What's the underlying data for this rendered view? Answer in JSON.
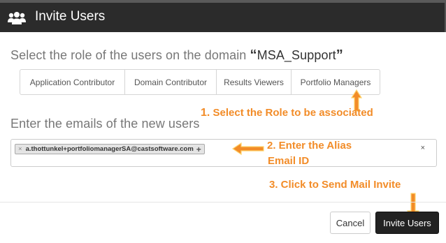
{
  "header": {
    "title": "Invite Users",
    "icon": "users-icon"
  },
  "role_section": {
    "prompt": "Select the role of the users on the domain",
    "domain": "MSA_Support",
    "open_quote": "“",
    "close_quote": "”",
    "roles": [
      {
        "label": "Application Contributor"
      },
      {
        "label": "Domain Contributor"
      },
      {
        "label": "Results Viewers"
      },
      {
        "label": "Portfolio Managers"
      }
    ]
  },
  "email_section": {
    "prompt": "Enter the emails of the new users",
    "chips": [
      {
        "label": "a.thottunkel+portfoliomanagerSA@castsoftware.com",
        "remove": "×",
        "add": "+"
      }
    ],
    "clear": "×"
  },
  "annotations": {
    "step1_num": "1.",
    "step1_text": "Select the Role to be associated",
    "step2_line1": "2.  Enter the Alias",
    "step2_line2": "Email ID",
    "step3": "3. Click to Send Mail Invite",
    "color": "#f28c28"
  },
  "footer": {
    "cancel_label": "Cancel",
    "invite_label": "Invite Users"
  },
  "colors": {
    "header_bg": "#2b2b2b",
    "annotation": "#f28c28",
    "primary_button": "#222222"
  }
}
